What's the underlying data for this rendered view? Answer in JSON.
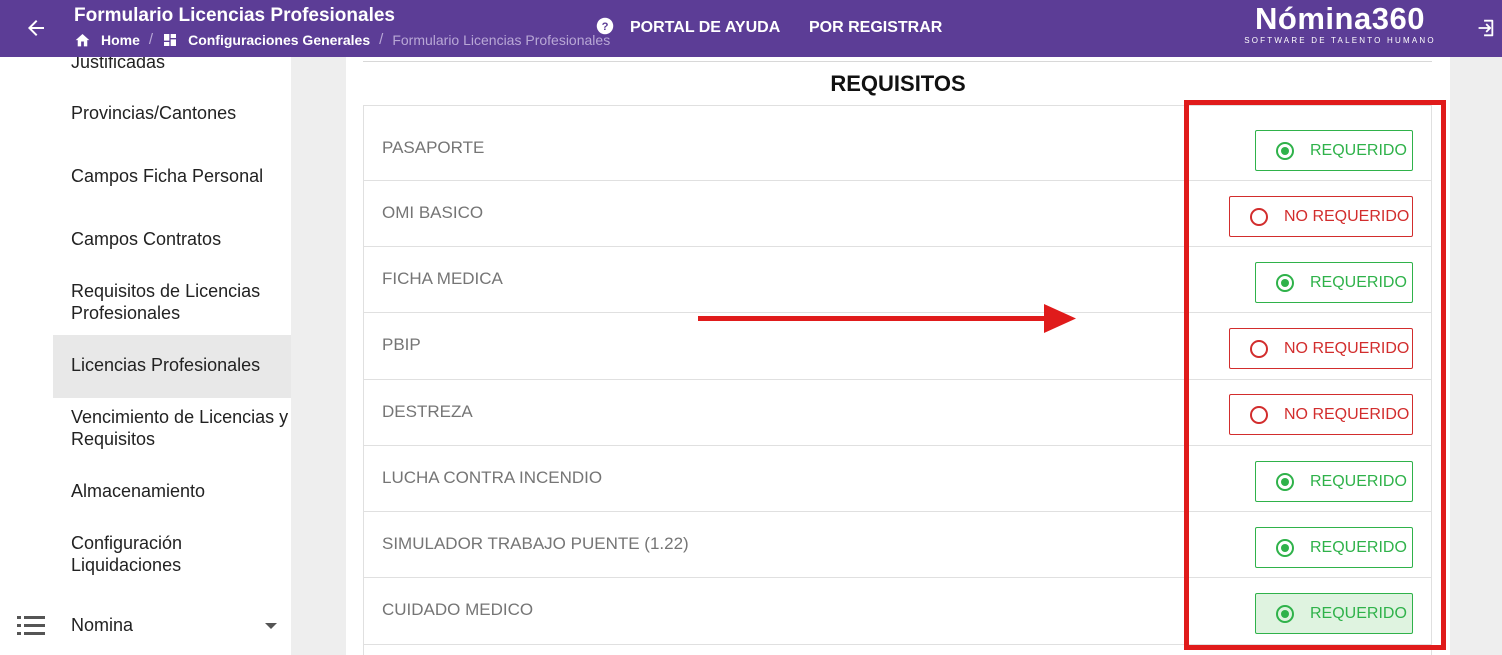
{
  "header": {
    "title": "Formulario Licencias Profesionales",
    "breadcrumb": {
      "home": "Home",
      "config": "Configuraciones Generales",
      "current": "Formulario Licencias Profesionales"
    },
    "nav": {
      "help": "PORTAL DE AYUDA",
      "register": "POR REGISTRAR"
    },
    "logo": {
      "brand": "Nómina360",
      "tagline": "SOFTWARE DE TALENTO HUMANO"
    }
  },
  "sidebar": {
    "items": [
      {
        "label": "Justificadas"
      },
      {
        "label": "Provincias/Cantones"
      },
      {
        "label": "Campos Ficha Personal"
      },
      {
        "label": "Campos Contratos"
      },
      {
        "label": "Requisitos de Licencias Profesionales"
      },
      {
        "label": "Licencias Profesionales"
      },
      {
        "label": "Vencimiento de Licencias y Requisitos"
      },
      {
        "label": "Almacenamiento"
      },
      {
        "label": "Configuración Liquidaciones"
      }
    ],
    "group": {
      "label": "Nomina"
    }
  },
  "requisitos": {
    "title": "REQUISITOS",
    "rows": [
      {
        "name": "PASAPORTE",
        "status": "REQUERIDO"
      },
      {
        "name": "OMI BASICO",
        "status": "NO REQUERIDO"
      },
      {
        "name": "FICHA MEDICA",
        "status": "REQUERIDO"
      },
      {
        "name": "PBIP",
        "status": "NO REQUERIDO"
      },
      {
        "name": "DESTREZA",
        "status": "NO REQUERIDO"
      },
      {
        "name": "LUCHA CONTRA INCENDIO",
        "status": "REQUERIDO"
      },
      {
        "name": "SIMULADOR TRABAJO PUENTE (1.22)",
        "status": "REQUERIDO"
      },
      {
        "name": "CUIDADO MEDICO",
        "status": "REQUERIDO"
      }
    ]
  },
  "colors": {
    "topbar": "#5c3d96",
    "required": "#2fb24a",
    "not_required": "#d22d2d",
    "annotation": "#e01b1b"
  }
}
